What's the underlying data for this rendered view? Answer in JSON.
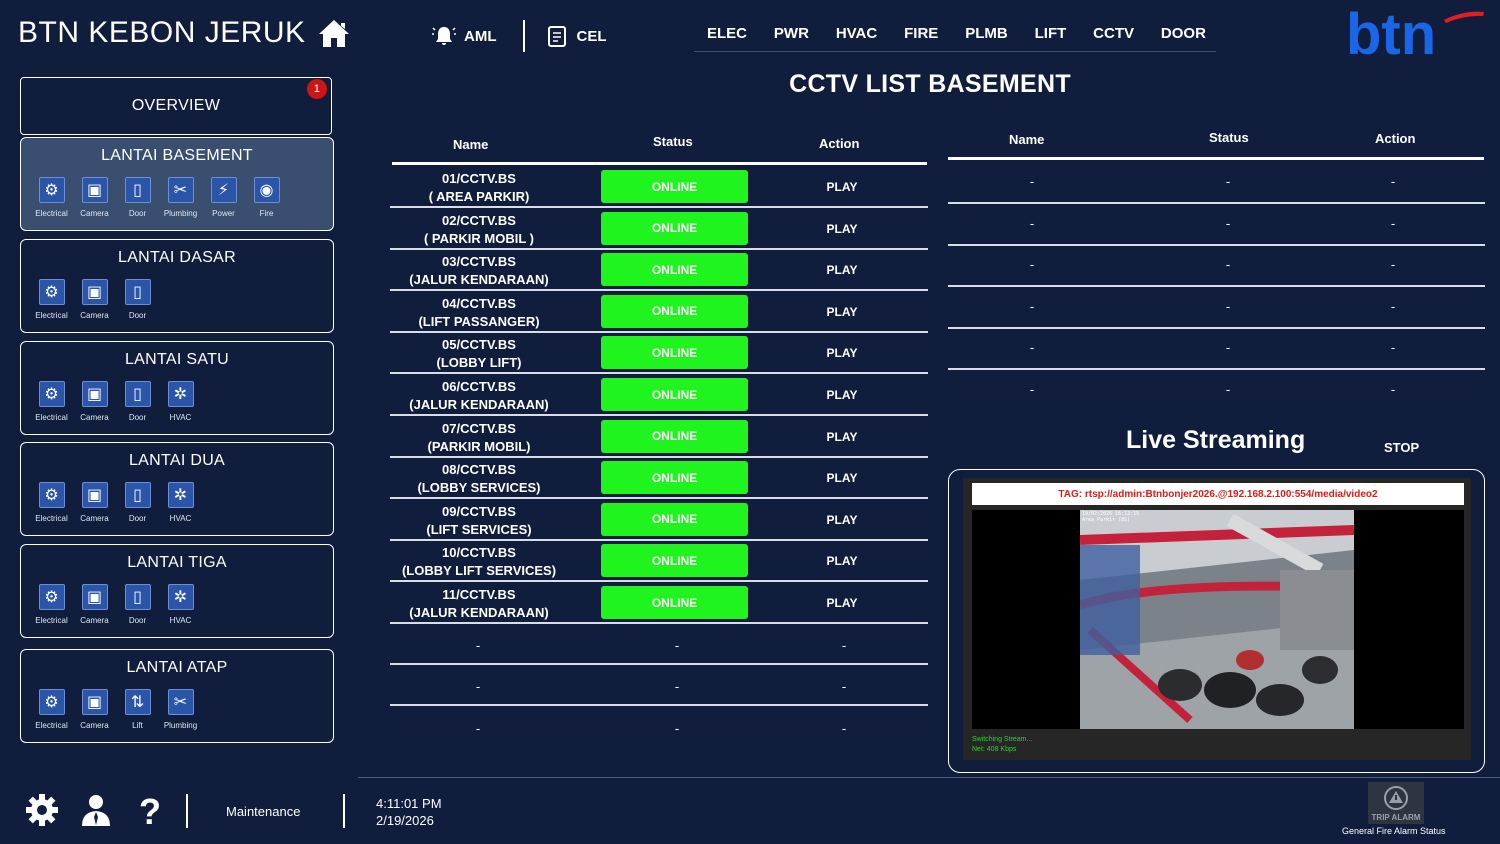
{
  "header": {
    "site_title": "BTN KEBON JERUK",
    "alarms": [
      {
        "label": "AML"
      },
      {
        "label": "CEL"
      }
    ],
    "systems": [
      "ELEC",
      "PWR",
      "HVAC",
      "FIRE",
      "PLMB",
      "LIFT",
      "CCTV",
      "DOOR"
    ],
    "logo_text": "btn",
    "brand_color": "#1a66e8",
    "logo_accent": "#e02020"
  },
  "sidebar": {
    "overview": {
      "label": "OVERVIEW",
      "badge": "1"
    },
    "floors": [
      {
        "title": "LANTAI BASEMENT",
        "active": true,
        "icons": [
          {
            "label": "Electrical",
            "icon": "electrical-icon"
          },
          {
            "label": "Camera",
            "icon": "camera-icon"
          },
          {
            "label": "Door",
            "icon": "door-icon"
          },
          {
            "label": "Plumbing",
            "icon": "plumbing-icon"
          },
          {
            "label": "Power",
            "icon": "power-icon"
          },
          {
            "label": "Fire",
            "icon": "fire-icon"
          }
        ]
      },
      {
        "title": "LANTAI DASAR",
        "active": false,
        "icons": [
          {
            "label": "Electrical",
            "icon": "electrical-icon"
          },
          {
            "label": "Camera",
            "icon": "camera-icon"
          },
          {
            "label": "Door",
            "icon": "door-icon"
          }
        ]
      },
      {
        "title": "LANTAI SATU",
        "active": false,
        "icons": [
          {
            "label": "Electrical",
            "icon": "electrical-icon"
          },
          {
            "label": "Camera",
            "icon": "camera-icon"
          },
          {
            "label": "Door",
            "icon": "door-icon"
          },
          {
            "label": "HVAC",
            "icon": "hvac-icon"
          }
        ]
      },
      {
        "title": "LANTAI DUA",
        "active": false,
        "icons": [
          {
            "label": "Electrical",
            "icon": "electrical-icon"
          },
          {
            "label": "Camera",
            "icon": "camera-icon"
          },
          {
            "label": "Door",
            "icon": "door-icon"
          },
          {
            "label": "HVAC",
            "icon": "hvac-icon"
          }
        ]
      },
      {
        "title": "LANTAI TIGA",
        "active": false,
        "icons": [
          {
            "label": "Electrical",
            "icon": "electrical-icon"
          },
          {
            "label": "Camera",
            "icon": "camera-icon"
          },
          {
            "label": "Door",
            "icon": "door-icon"
          },
          {
            "label": "HVAC",
            "icon": "hvac-icon"
          }
        ]
      },
      {
        "title": "LANTAI ATAP",
        "active": false,
        "icons": [
          {
            "label": "Electrical",
            "icon": "electrical-icon"
          },
          {
            "label": "Camera",
            "icon": "camera-icon"
          },
          {
            "label": "Lift",
            "icon": "lift-icon"
          },
          {
            "label": "Plumbing",
            "icon": "plumbing-icon"
          }
        ]
      }
    ]
  },
  "main": {
    "title": "CCTV LIST BASEMENT",
    "table_left": {
      "columns": [
        "Name",
        "Status",
        "Action"
      ],
      "rows": [
        {
          "name": "01/CCTV.BS",
          "location": "( AREA PARKIR)",
          "status": "ONLINE",
          "action": "PLAY"
        },
        {
          "name": "02/CCTV.BS",
          "location": "( PARKIR MOBIL )",
          "status": "ONLINE",
          "action": "PLAY"
        },
        {
          "name": "03/CCTV.BS",
          "location": "(JALUR KENDARAAN)",
          "status": "ONLINE",
          "action": "PLAY"
        },
        {
          "name": "04/CCTV.BS",
          "location": "(LIFT PASSANGER)",
          "status": "ONLINE",
          "action": "PLAY"
        },
        {
          "name": "05/CCTV.BS",
          "location": "(LOBBY LIFT)",
          "status": "ONLINE",
          "action": "PLAY"
        },
        {
          "name": "06/CCTV.BS",
          "location": "(JALUR KENDARAAN)",
          "status": "ONLINE",
          "action": "PLAY"
        },
        {
          "name": "07/CCTV.BS",
          "location": "(PARKIR MOBIL)",
          "status": "ONLINE",
          "action": "PLAY"
        },
        {
          "name": "08/CCTV.BS",
          "location": "(LOBBY SERVICES)",
          "status": "ONLINE",
          "action": "PLAY"
        },
        {
          "name": "09/CCTV.BS",
          "location": "(LIFT SERVICES)",
          "status": "ONLINE",
          "action": "PLAY"
        },
        {
          "name": "10/CCTV.BS",
          "location": "(LOBBY LIFT SERVICES)",
          "status": "ONLINE",
          "action": "PLAY"
        },
        {
          "name": "11/CCTV.BS",
          "location": "(JALUR KENDARAAN)",
          "status": "ONLINE",
          "action": "PLAY"
        }
      ],
      "empty_rows": 3,
      "placeholder": "-",
      "online_color": "#1ff41f"
    },
    "table_right": {
      "columns": [
        "Name",
        "Status",
        "Action"
      ],
      "empty_rows": 6,
      "placeholder": "-"
    }
  },
  "live": {
    "title": "Live Streaming",
    "stop_label": "STOP",
    "tag": "TAG: rtsp://admin:Btnbonjer2026.@192.168.2.100:554/media/video2",
    "timestamp": "19/02/2026 16:12:15",
    "camera_label": "Area Parkir  (BS)",
    "status_line1": "Switching Stream...",
    "status_line2": "Net: 408 Kbps"
  },
  "footer": {
    "icons": [
      "settings-icon",
      "user-icon",
      "help-icon"
    ],
    "maintenance": "Maintenance",
    "time": "4:11:01 PM",
    "date": "2/19/2026",
    "trip_alarm": "TRIP ALARM",
    "fire_alarm_status": "General Fire Alarm Status"
  }
}
